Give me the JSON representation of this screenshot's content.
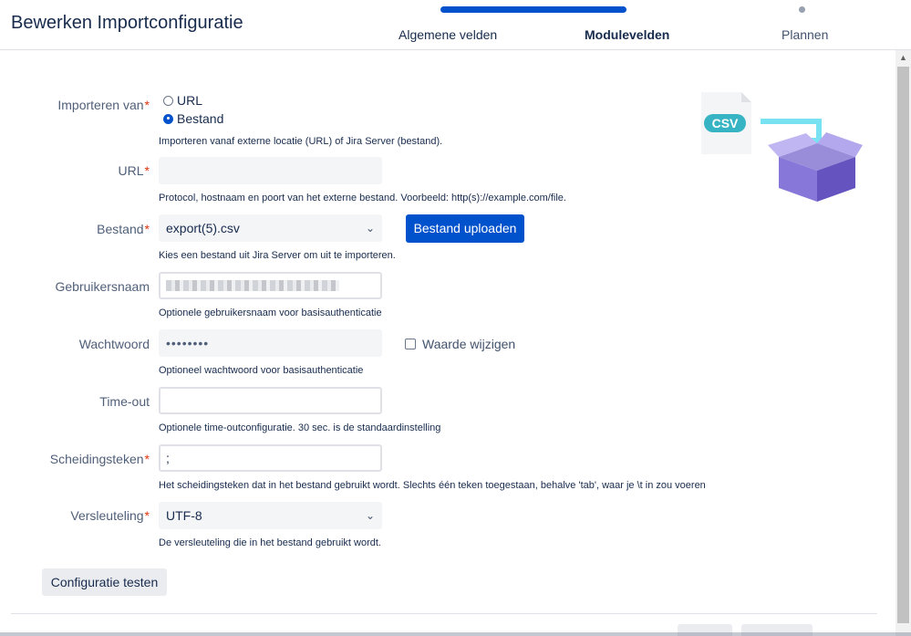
{
  "header": {
    "title": "Bewerken Importconfiguratie",
    "steps": [
      {
        "label": "Algemene velden",
        "state": "completed"
      },
      {
        "label": "Modulevelden",
        "state": "current"
      },
      {
        "label": "Plannen",
        "state": "upcoming"
      }
    ]
  },
  "form": {
    "import_from": {
      "label": "Importeren van",
      "options": [
        "URL",
        "Bestand"
      ],
      "selected": "Bestand",
      "help": "Importeren vanaf externe locatie (URL) of Jira Server (bestand)."
    },
    "url": {
      "label": "URL",
      "value": "",
      "help": "Protocol, hostnaam en poort van het externe bestand. Voorbeeld: http(s)://example.com/file."
    },
    "file": {
      "label": "Bestand",
      "value": "export(5).csv",
      "upload_button": "Bestand uploaden",
      "help": "Kies een bestand uit Jira Server om uit te importeren."
    },
    "username": {
      "label": "Gebruikersnaam",
      "help": "Optionele gebruikersnaam voor basisauthenticatie"
    },
    "password": {
      "label": "Wachtwoord",
      "value": "••••••••",
      "change_checkbox": "Waarde wijzigen",
      "help": "Optioneel wachtwoord voor basisauthenticatie"
    },
    "timeout": {
      "label": "Time-out",
      "value": "",
      "help": "Optionele time-outconfiguratie. 30 sec. is de standaardinstelling"
    },
    "delimiter": {
      "label": "Scheidingsteken",
      "value": ";",
      "help": "Het scheidingsteken dat in het bestand gebruikt wordt. Slechts één teken toegestaan, behalve 'tab', waar je \\t in zou voeren"
    },
    "encoding": {
      "label": "Versleuteling",
      "value": "UTF-8",
      "help": "De versleuteling die in het bestand gebruikt wordt."
    },
    "required_marker": "*",
    "test_button": "Configuratie testen"
  },
  "illustration": {
    "badge": "CSV"
  },
  "colors": {
    "primary": "#0052cc",
    "required": "#de350b",
    "illustration_teal": "#36b4c3",
    "illustration_purple": "#8777d9"
  }
}
